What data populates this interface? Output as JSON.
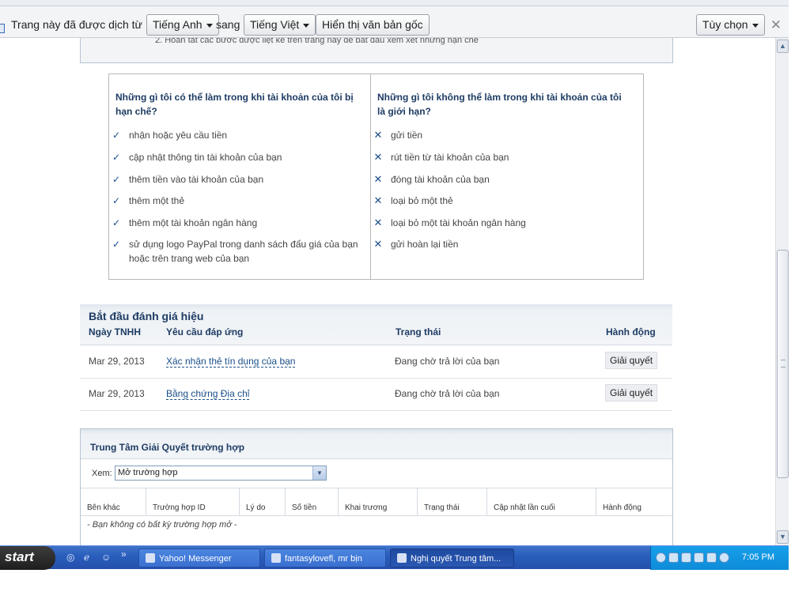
{
  "translate_bar": {
    "prefix": "Trang này đã được dịch từ",
    "from_lang": "Tiếng Anh",
    "joiner": "sang",
    "to_lang": "Tiếng Việt",
    "show_original": "Hiển thị văn bản gốc",
    "options": "Tùy chọn",
    "close_glyph": "✕"
  },
  "notice_text": "2.   Hoàn tất các bước được liệt kê trên trang này để bắt đầu xem xét những hạn chế",
  "limits": {
    "can_title": "Những gì tôi có thể làm trong khi tài khoản của tôi bị hạn chế?",
    "can_items": [
      "nhận hoặc yêu cầu tiền",
      "cập nhật thông tin tài khoản của bạn",
      "thêm tiền vào tài khoản của bạn",
      "thêm một thẻ",
      "thêm một tài khoản ngân hàng",
      "sử dụng logo PayPal trong danh sách đấu giá của bạn hoặc trên trang web của bạn"
    ],
    "cannot_title": "Những gì tôi không thể làm trong khi tài khoản của tôi là giới hạn?",
    "cannot_items": [
      "gửi tiền",
      "rút tiền từ tài khoản của bạn",
      "đóng tài khoản của bạn",
      "loại bỏ một thẻ",
      "loại bỏ một tài khoản ngân hàng",
      "gửi hoàn lại tiền"
    ],
    "check_glyph": "✓",
    "x_glyph": "✕"
  },
  "review": {
    "title": "Bắt đầu đánh giá hiệu",
    "headers": [
      "Ngày TNHH",
      "Yêu cầu đáp ứng",
      "Trạng thái",
      "Hành động"
    ],
    "rows": [
      {
        "date": "Mar 29, 2013",
        "request": "Xác nhận thẻ tín dụng của bạn",
        "status": "Đang chờ trả lời của bạn",
        "action": "Giải quyết"
      },
      {
        "date": "Mar 29, 2013",
        "request": "Bằng chứng Địa chỉ",
        "status": "Đang chờ trả lời của bạn",
        "action": "Giải quyết"
      }
    ]
  },
  "cases": {
    "title": "Trung Tâm Giải Quyết trường hợp",
    "view_label": "Xem:",
    "view_value": "Mở trường hợp",
    "columns": [
      "Bên khác",
      "Trường hợp ID",
      "Lý do",
      "Số tiền",
      "Khai trương",
      "Trạng thái",
      "Cập nhật lần cuối",
      "Hành động"
    ],
    "empty_text": "- Bạn không có bất kỳ trường hợp mở -"
  },
  "taskbar": {
    "start": "start",
    "overflow": "»",
    "buttons": [
      {
        "label": "Yahoo! Messenger"
      },
      {
        "label": "fantasylovefl, mr bịn"
      },
      {
        "label": "Nghị quyết Trung tâm..."
      }
    ],
    "clock": "7:05 PM"
  },
  "colors": {
    "heading": "#1e3c64",
    "link": "#1a4e8a",
    "taskbar": "#2a5fbd",
    "tray": "#0d8bd9"
  }
}
